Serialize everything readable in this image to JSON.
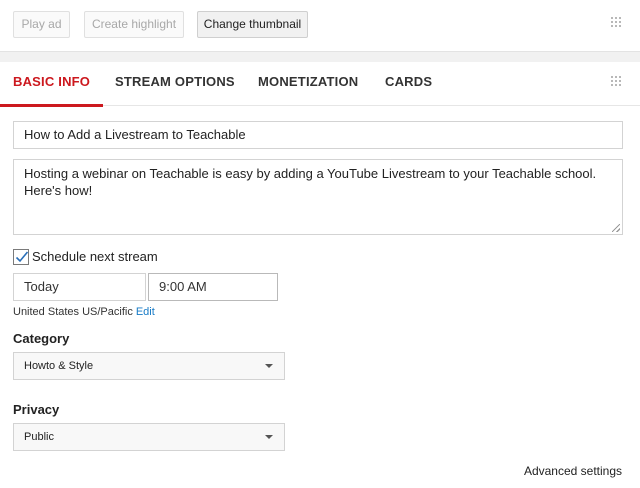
{
  "toolbar": {
    "play_ad": "Play ad",
    "create_highlight": "Create highlight",
    "change_thumbnail": "Change thumbnail"
  },
  "tabs": [
    {
      "label": "BASIC INFO",
      "active": true
    },
    {
      "label": "STREAM OPTIONS",
      "active": false
    },
    {
      "label": "MONETIZATION",
      "active": false
    },
    {
      "label": "CARDS",
      "active": false
    }
  ],
  "form": {
    "title": "How to Add a Livestream to Teachable",
    "description": "Hosting a webinar on Teachable is easy by adding a YouTube Livestream to your Teachable school. Here's how!",
    "schedule_label": "Schedule next stream",
    "schedule_checked": true,
    "date": "Today",
    "time": "9:00 AM",
    "timezone": "United States US/Pacific",
    "timezone_edit": "Edit",
    "category_label": "Category",
    "category_value": "Howto & Style",
    "privacy_label": "Privacy",
    "privacy_value": "Public",
    "advanced_settings": "Advanced settings"
  },
  "icons": {
    "grip": "drag-grip-icon",
    "dropdown": "chevron-down-icon",
    "check": "checkmark-icon"
  },
  "colors": {
    "accent": "#cc181e",
    "link": "#167ac6"
  }
}
